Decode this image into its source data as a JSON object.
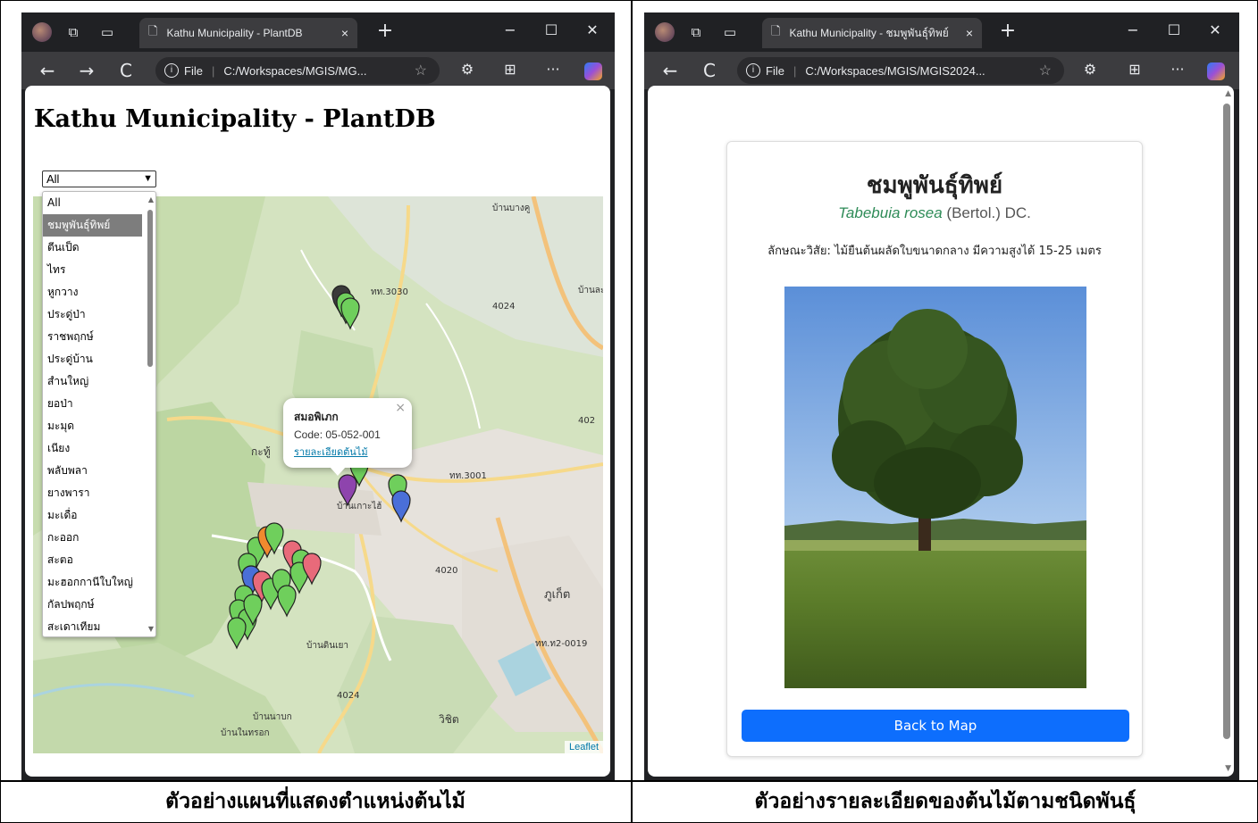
{
  "left": {
    "tab": {
      "title": "Kathu Municipality - PlantDB",
      "close": "×"
    },
    "nav": {
      "file_label": "File",
      "url": "C:/Workspaces/MGIS/MG..."
    },
    "page_title": "Kathu Municipality - PlantDB",
    "filter": {
      "selected": "All"
    },
    "dropdown_options": [
      "All",
      "ชมพูพันธุ์ทิพย์",
      "ตีนเป็ด",
      "ไทร",
      "หูกวาง",
      "ประดู่ป่า",
      "ราชพฤกษ์",
      "ประดู่บ้าน",
      "สำนใหญ่",
      "ยอป่า",
      "มะมุด",
      "เนียง",
      "พลับพลา",
      "ยางพารา",
      "มะเดื่อ",
      "กะออก",
      "สะตอ",
      "มะฮอกกานีใบใหญ่",
      "กัลปพฤกษ์",
      "สะเดาเทียม"
    ],
    "dropdown_highlight_index": 1,
    "popup": {
      "name": "สมอพิเภก",
      "code": "Code: 05-052-001",
      "link": "รายละเอียดต้นไม้",
      "close": "×"
    },
    "map_labels": [
      "บ้านบางคู",
      "ทท.3030",
      "4024",
      "บ้านละ",
      "402",
      "กะทู้",
      "บ้านเกาะไฮ้",
      "ทท.3001",
      "4020",
      "ภูเก็ต",
      "บ้านดินเยา",
      "ทท.ท2-0019",
      "4024",
      "วิชิต",
      "บ้านนาบก",
      "บ้านในทรอก"
    ],
    "attribution": "Leaflet",
    "caption": "ตัวอย่างแผนที่แสดงตำแหน่งต้นไม้"
  },
  "right": {
    "tab": {
      "title": "Kathu Municipality - ชมพูพันธุ์ทิพย์",
      "close": "×"
    },
    "nav": {
      "file_label": "File",
      "url": "C:/Workspaces/MGIS/MGIS2024..."
    },
    "species_name": "ชมพูพันธุ์ทิพย์",
    "genus_species": "Tabebuia rosea",
    "author": "(Bertol.) DC.",
    "habit": "ลักษณะวิสัย: ไม้ยืนต้นผลัดใบขนาดกลาง มีความสูงได้ 15-25 เมตร",
    "back_button": "Back to Map",
    "caption": "ตัวอย่างรายละเอียดของต้นไม้ตามชนิดพันธุ์"
  },
  "icons": {
    "back": "←",
    "forward": "→",
    "reload": "C",
    "new_tab": "+",
    "minimize": "−",
    "maximize": "☐",
    "close": "✕",
    "info": "i",
    "star": "☆",
    "more": "···",
    "collections": "⊞"
  },
  "colors": {
    "chrome_dark": "#202124",
    "toolbar": "#3c3c3f",
    "button_blue": "#0d6efd",
    "genus_green": "#2e8b57",
    "link_blue": "#0078a8"
  }
}
